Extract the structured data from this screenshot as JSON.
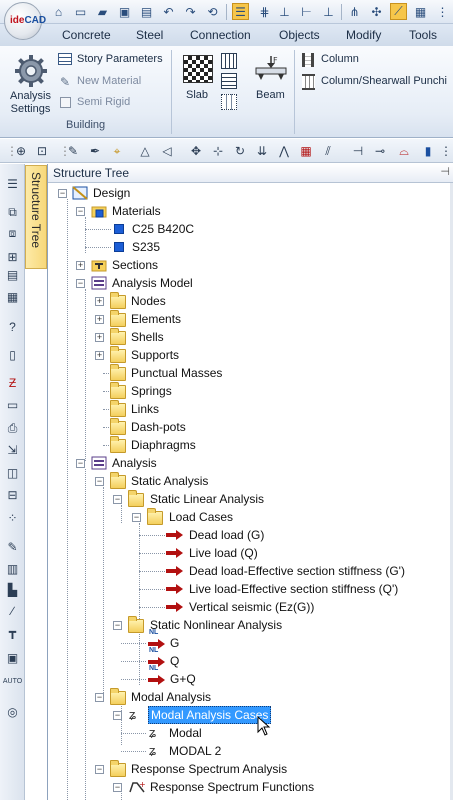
{
  "app": {
    "logo_text_a": "ide",
    "logo_text_b": "CAD"
  },
  "tabs": [
    "Concrete",
    "Steel",
    "Connection",
    "Objects",
    "Modify",
    "Tools"
  ],
  "ribbon": {
    "analysis_settings": "Analysis\nSettings",
    "story_parameters": "Story Parameters",
    "new_material": "New Material",
    "semi_rigid": "Semi Rigid",
    "building_group": "Building",
    "slab": "Slab",
    "beam": "Beam",
    "column": "Column",
    "column_shearwall": "Column/Shearwall Punchi"
  },
  "vertical_tab": "Structure Tree",
  "panel": {
    "title": "Structure Tree",
    "pin": "⊣"
  },
  "tree": [
    {
      "label": "Design"
    },
    {
      "label": "Materials"
    },
    {
      "label": "C25 B420C"
    },
    {
      "label": "S235"
    },
    {
      "label": "Sections"
    },
    {
      "label": "Analysis Model"
    },
    {
      "label": "Nodes"
    },
    {
      "label": "Elements"
    },
    {
      "label": "Shells"
    },
    {
      "label": "Supports"
    },
    {
      "label": "Punctual Masses"
    },
    {
      "label": "Springs"
    },
    {
      "label": "Links"
    },
    {
      "label": "Dash-pots"
    },
    {
      "label": "Diaphragms"
    },
    {
      "label": "Analysis"
    },
    {
      "label": "Static Analysis"
    },
    {
      "label": "Static Linear Analysis"
    },
    {
      "label": "Load Cases"
    },
    {
      "label": "Dead load (G)"
    },
    {
      "label": "Live load (Q)"
    },
    {
      "label": "Dead load-Effective section stiffness (G')"
    },
    {
      "label": "Live load-Effective section stiffness (Q')"
    },
    {
      "label": "Vertical seismic (Ez(G))"
    },
    {
      "label": "Static Nonlinear Analysis"
    },
    {
      "label": "G"
    },
    {
      "label": "Q"
    },
    {
      "label": "G+Q"
    },
    {
      "label": "Modal Analysis"
    },
    {
      "label": "Modal Analysis Cases"
    },
    {
      "label": "Modal"
    },
    {
      "label": "MODAL 2"
    },
    {
      "label": "Response Spectrum Analysis"
    },
    {
      "label": "Response Spectrum Functions"
    }
  ],
  "icon_labels": {
    "nl": "NL"
  },
  "colors": {
    "selection": "#3399ff",
    "arrow": "#b21010",
    "material": "#1c5ed6"
  }
}
